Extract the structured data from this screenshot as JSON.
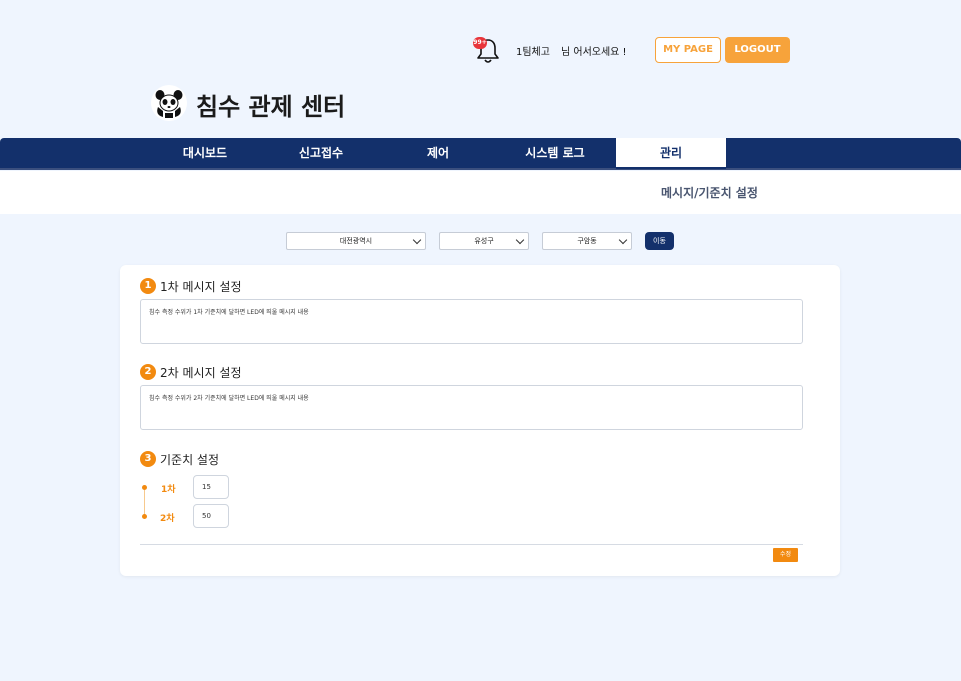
{
  "header": {
    "notification_count": "99+",
    "user_name": "1팀체고",
    "welcome": "님 어서오세요 !",
    "mypage_label": "MY PAGE",
    "logout_label": "LOGOUT"
  },
  "logo": {
    "title": "침수 관제 센터"
  },
  "nav": {
    "items": [
      {
        "label": "대시보드"
      },
      {
        "label": "신고접수"
      },
      {
        "label": "제어"
      },
      {
        "label": "시스템 로그"
      },
      {
        "label": "관리"
      }
    ],
    "active": "관리",
    "sub_item": "메시지/기준치 설정"
  },
  "filters": {
    "city": "대전광역시",
    "district": "유성구",
    "dong": "구암동",
    "move_label": "이동"
  },
  "sections": [
    {
      "num": "1",
      "title": "1차 메시지 설정",
      "text": "침수 측정 수위가 1차 기준치에 달하면 LED에 띄울 메시지 내용"
    },
    {
      "num": "2",
      "title": "2차 메시지 설정",
      "text": "침수 측정 수위가 2차 기준치에 달하면 LED에 띄울 메시지 내용"
    },
    {
      "num": "3",
      "title": "기준치 설정"
    }
  ],
  "thresholds": [
    {
      "label": "1차",
      "value": "15"
    },
    {
      "label": "2차",
      "value": "50"
    }
  ],
  "edit_label": "수정",
  "colors": {
    "nav": "#13306b",
    "accent": "#f7a33b",
    "section_number": "#f28a10",
    "badge": "#e8353b",
    "background": "#eff5fe"
  }
}
